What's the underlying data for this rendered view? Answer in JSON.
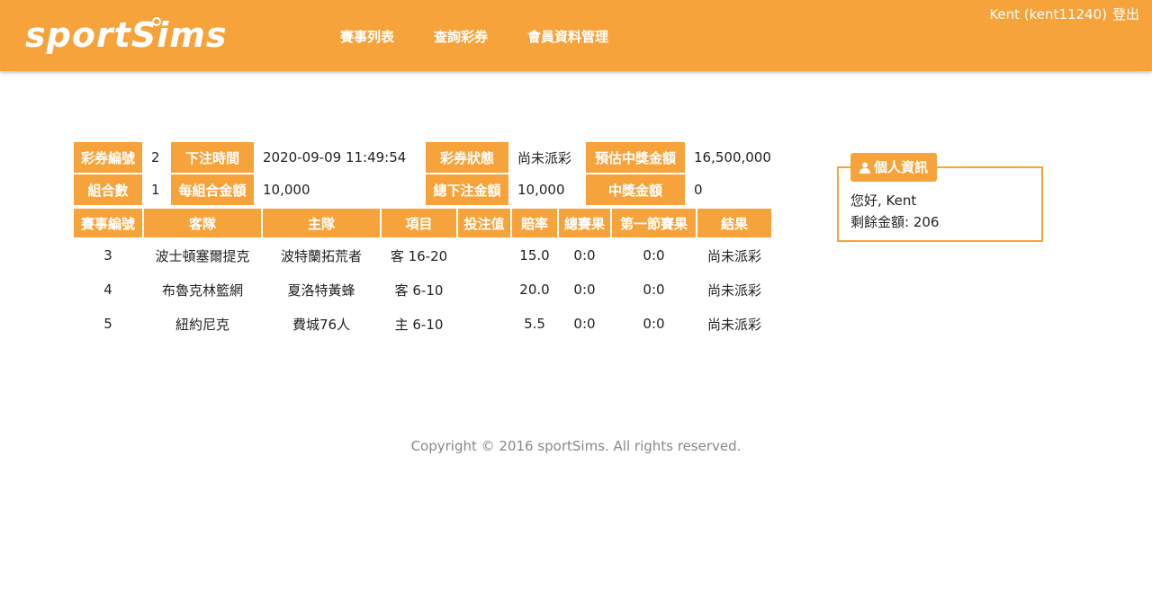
{
  "header": {
    "logo_text": "sportSims",
    "nav": [
      "賽事列表",
      "查詢彩券",
      "會員資料管理"
    ],
    "user_label": "Kent (kent11240)",
    "logout": "登出"
  },
  "ticket": {
    "ticket_no_label": "彩券編號",
    "ticket_no": "2",
    "bet_time_label": "下注時間",
    "bet_time": "2020-09-09 11:49:54",
    "status_label": "彩券狀態",
    "status": "尚未派彩",
    "est_prize_label": "預估中獎金額",
    "est_prize": "16,500,000",
    "combos_label": "組合數",
    "combos": "1",
    "per_combo_label": "每組合金額",
    "per_combo": "10,000",
    "total_bet_label": "總下注金額",
    "total_bet": "10,000",
    "prize_label": "中獎金額",
    "prize": "0"
  },
  "games": {
    "headers": [
      "賽事編號",
      "客隊",
      "主隊",
      "項目",
      "投注值",
      "賠率",
      "總賽果",
      "第一節賽果",
      "結果"
    ],
    "rows": [
      [
        "3",
        "波士頓塞爾提克",
        "波特蘭拓荒者",
        "客 16-20",
        "",
        "15.0",
        "0:0",
        "0:0",
        "尚未派彩"
      ],
      [
        "4",
        "布魯克林籃網",
        "夏洛特黃蜂",
        "客 6-10",
        "",
        "20.0",
        "0:0",
        "0:0",
        "尚未派彩"
      ],
      [
        "5",
        "紐約尼克",
        "費城76人",
        "主 6-10",
        "",
        "5.5",
        "0:0",
        "0:0",
        "尚未派彩"
      ]
    ]
  },
  "personal": {
    "title": "個人資訊",
    "greeting": "您好, Kent",
    "balance": "剩餘金額: 206",
    "icon": "user-icon"
  },
  "footer": "Copyright © 2016 sportSims. All rights reserved.",
  "colors": {
    "accent": "#f7a33b"
  }
}
